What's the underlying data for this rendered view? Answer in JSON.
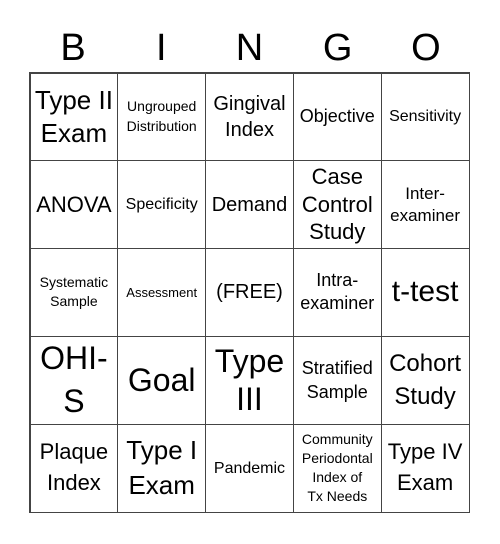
{
  "header": {
    "letters": [
      "B",
      "I",
      "N",
      "G",
      "O"
    ]
  },
  "cells": [
    "Type II\nExam",
    "Ungrouped\nDistribution",
    "Gingival\nIndex",
    "Objective",
    "Sensitivity",
    "ANOVA",
    "Specificity",
    "Demand",
    "Case\nControl\nStudy",
    "Inter-\nexaminer",
    "Systematic\nSample",
    "Assessment",
    "(FREE)",
    "Intra-\nexaminer",
    "t-test",
    "OHI-\nS",
    "Goal",
    "Type\nIII",
    "Stratified\nSample",
    "Cohort\nStudy",
    "Plaque\nIndex",
    "Type I\nExam",
    "Pandemic",
    "Community\nPeriodontal\nIndex of\nTx Needs",
    "Type IV\nExam"
  ]
}
